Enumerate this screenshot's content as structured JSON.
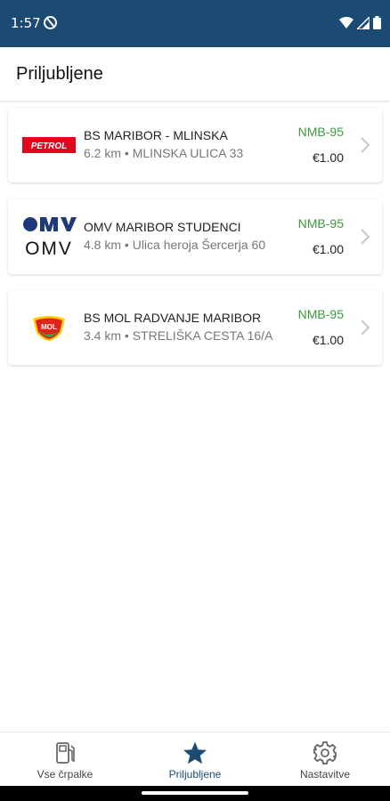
{
  "status_bar": {
    "time": "1:57"
  },
  "header": {
    "title": "Priljubljene"
  },
  "stations": [
    {
      "brand": "PETROL",
      "name": "BS MARIBOR - MLINSKA",
      "distance": "6.2 km",
      "address": "MLINSKA ULICA 33",
      "fuel": "NMB-95",
      "price": "€1.00"
    },
    {
      "brand": "OMV",
      "name": "OMV MARIBOR STUDENCI",
      "distance": "4.8 km",
      "address": "Ulica heroja Šercerja 60",
      "fuel": "NMB-95",
      "price": "€1.00"
    },
    {
      "brand": "MOL",
      "name": "BS MOL RADVANJE MARIBOR",
      "distance": "3.4 km",
      "address": "STRELIŠKA CESTA 16/A",
      "fuel": "NMB-95",
      "price": "€1.00"
    }
  ],
  "separator": " • ",
  "bottom_nav": {
    "items": [
      {
        "label": "Vse črpalke",
        "icon": "fuel-pump-icon",
        "active": false
      },
      {
        "label": "Priljubljene",
        "icon": "star-icon",
        "active": true
      },
      {
        "label": "Nastavitve",
        "icon": "gear-icon",
        "active": false
      }
    ]
  },
  "colors": {
    "primary": "#1b4a72",
    "fuel_label": "#3b9b3d",
    "petrol_red": "#e3051b",
    "omv_blue": "#1e3a7a",
    "mol_red": "#e2231a",
    "mol_yellow": "#ffcc00"
  }
}
